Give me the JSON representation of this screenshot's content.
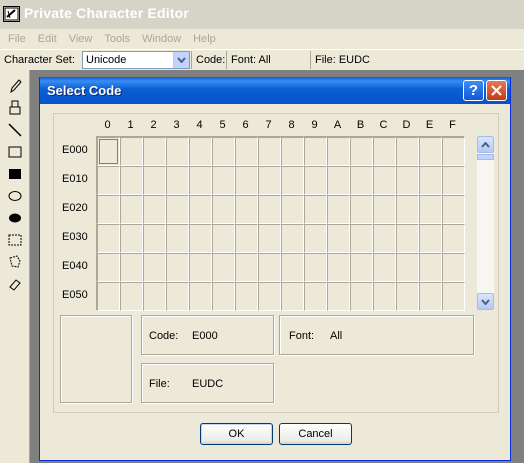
{
  "app": {
    "title": "Private Character Editor"
  },
  "menu": [
    "File",
    "Edit",
    "View",
    "Tools",
    "Window",
    "Help"
  ],
  "charset_bar": {
    "label": "Character Set:",
    "value": "Unicode",
    "code_label": "Code:",
    "font_label": "Font: All",
    "file_label": "File: EUDC"
  },
  "tools": [
    "pencil-icon",
    "brush-icon",
    "line-icon",
    "hollow-rectangle-icon",
    "filled-rectangle-icon",
    "hollow-ellipse-icon",
    "filled-ellipse-icon",
    "rectangular-selection-icon",
    "freeform-selection-icon",
    "eraser-icon"
  ],
  "dialog": {
    "title": "Select Code",
    "help_symbol": "?",
    "columns": [
      "0",
      "1",
      "2",
      "3",
      "4",
      "5",
      "6",
      "7",
      "8",
      "9",
      "A",
      "B",
      "C",
      "D",
      "E",
      "F"
    ],
    "rows": [
      "E000",
      "E010",
      "E020",
      "E030",
      "E040",
      "E050"
    ],
    "selected_code": "E000",
    "info": {
      "code_label": "Code:",
      "code_value": "E000",
      "font_label": "Font:",
      "font_value": "All",
      "file_label": "File:",
      "file_value": "EUDC"
    },
    "ok_label": "OK",
    "cancel_label": "Cancel"
  }
}
